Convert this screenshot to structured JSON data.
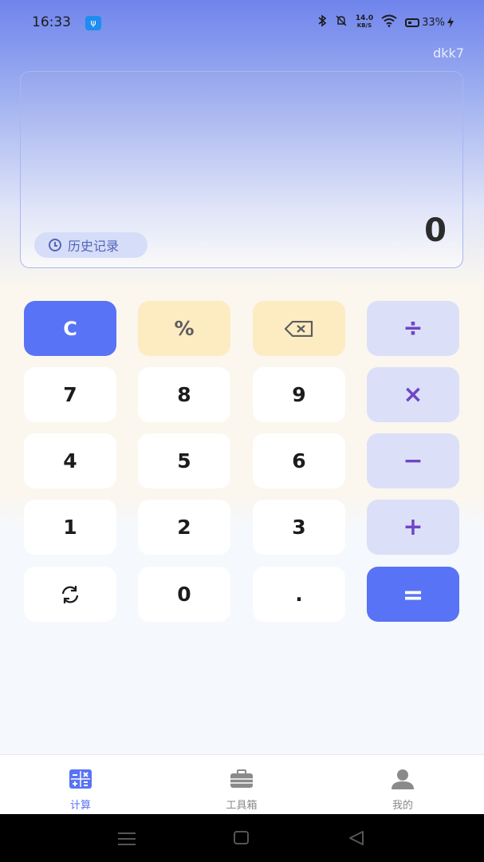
{
  "status_bar": {
    "time": "16:33",
    "usb_icon": "usb-icon",
    "net_speed_value": "14.0",
    "net_speed_unit": "KB/S",
    "battery": "33%"
  },
  "user": "dkk7",
  "display": {
    "history_label": "历史记录",
    "result": "0"
  },
  "keypad": {
    "clear": "C",
    "percent": "%",
    "divide": "÷",
    "multiply": "×",
    "minus": "−",
    "plus": "+",
    "equals": "=",
    "seven": "7",
    "eight": "8",
    "nine": "9",
    "four": "4",
    "five": "5",
    "six": "6",
    "one": "1",
    "two": "2",
    "three": "3",
    "zero": "0",
    "dot": "."
  },
  "tabs": [
    {
      "label": "计算",
      "icon": "calculator-icon",
      "active": true
    },
    {
      "label": "工具箱",
      "icon": "toolbox-icon",
      "active": false
    },
    {
      "label": "我的",
      "icon": "person-icon",
      "active": false
    }
  ],
  "colors": {
    "accent": "#5873f5",
    "operator_bg": "#dbe0f8",
    "operator_fg": "#6f46c4",
    "utility_bg": "#fdebc2"
  }
}
